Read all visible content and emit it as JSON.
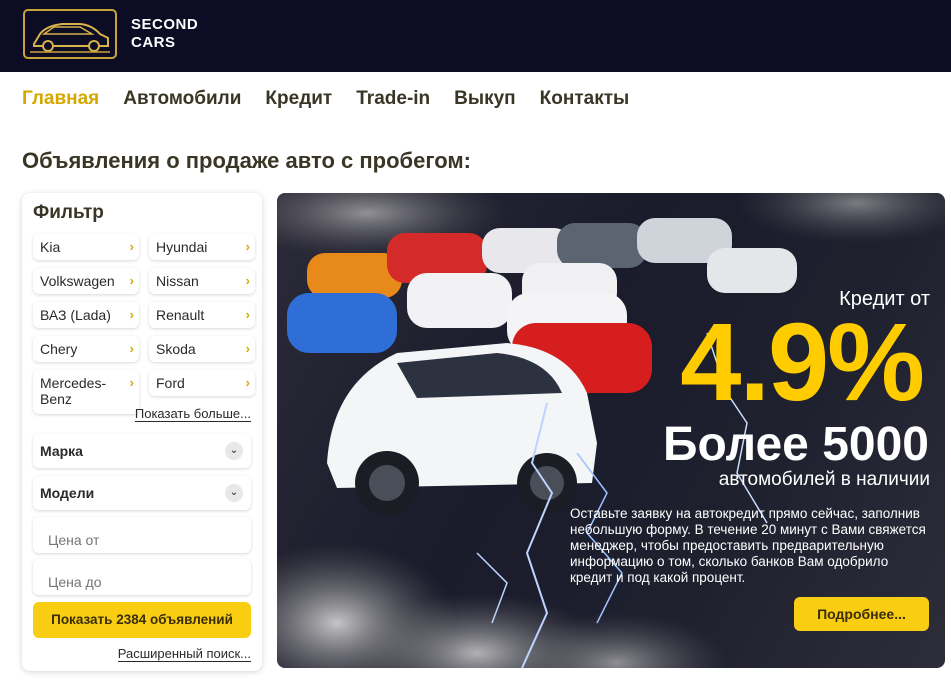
{
  "header": {
    "logo_line1": "SECOND",
    "logo_line2": "CARS"
  },
  "nav": {
    "items": [
      {
        "label": "Главная",
        "active": true
      },
      {
        "label": "Автомобили",
        "active": false
      },
      {
        "label": "Кредит",
        "active": false
      },
      {
        "label": "Trade-in",
        "active": false
      },
      {
        "label": "Выкуп",
        "active": false
      },
      {
        "label": "Контакты",
        "active": false
      }
    ]
  },
  "page": {
    "title": "Объявления о продаже авто с пробегом:"
  },
  "filter": {
    "title": "Фильтр",
    "brands": [
      "Kia",
      "Hyundai",
      "Volkswagen",
      "Nissan",
      "ВАЗ (Lada)",
      "Renault",
      "Chery",
      "Skoda",
      "Mercedes-Benz",
      "Ford"
    ],
    "brand_chevron": "›",
    "more_link": "Показать больше...",
    "make_select": "Марка",
    "model_select": "Модели",
    "price_from_placeholder": "Цена от",
    "price_to_placeholder": "Цена до",
    "show_button": "Показать 2384 объявлений",
    "advanced_link": "Расширенный поиск..."
  },
  "banner": {
    "credit_from": "Кредит от",
    "rate": "4.9%",
    "more_than": "Более 5000",
    "in_stock": "автомобилей в наличии",
    "description": "Оставьте заявку на автокредит прямо сейчас, заполнив небольшую форму. В течение 20 минут с Вами свяжется менеджер, чтобы предоставить предварительную информацию о том, сколько банков Вам одобрило кредит и под какой процент.",
    "button": "Подробнее..."
  },
  "colors": {
    "header_bg": "#0c0d24",
    "accent": "#f8cd12",
    "active_nav": "#d4a800",
    "text_dark": "#3a3626"
  }
}
